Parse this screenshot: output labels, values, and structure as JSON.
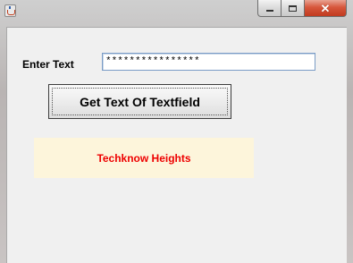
{
  "window": {
    "icon": "java-cup-icon",
    "controls": {
      "minimize_icon": "minimize-icon",
      "maximize_icon": "maximize-icon",
      "close_icon": "close-icon"
    }
  },
  "form": {
    "label": "Enter Text",
    "text_value": "****************",
    "button_label": "Get Text Of Textfield",
    "output_text": "Techknow Heights",
    "output_color": "#ee0000",
    "output_background": "#fdf5db"
  }
}
